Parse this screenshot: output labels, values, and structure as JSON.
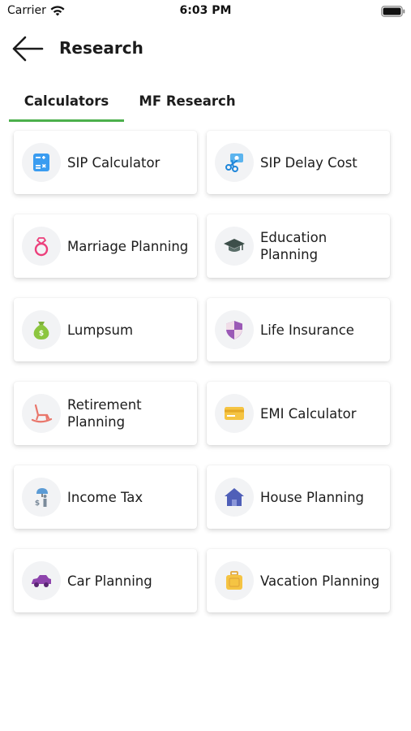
{
  "status_bar": {
    "carrier": "Carrier",
    "time": "6:03 PM"
  },
  "header": {
    "title": "Research"
  },
  "tabs": [
    {
      "label": "Calculators"
    },
    {
      "label": "MF Research"
    }
  ],
  "cards": [
    {
      "label": "SIP Calculator"
    },
    {
      "label": "SIP Delay Cost"
    },
    {
      "label": "Marriage Planning"
    },
    {
      "label": "Education Planning"
    },
    {
      "label": "Lumpsum"
    },
    {
      "label": "Life Insurance"
    },
    {
      "label": "Retirement Planning"
    },
    {
      "label": "EMI Calculator"
    },
    {
      "label": "Income Tax"
    },
    {
      "label": "House Planning"
    },
    {
      "label": "Car Planning"
    },
    {
      "label": "Vacation Planning"
    }
  ],
  "colors": {
    "tab_indicator": "#4cb04c",
    "icon_bg": "#f2f3f5"
  }
}
